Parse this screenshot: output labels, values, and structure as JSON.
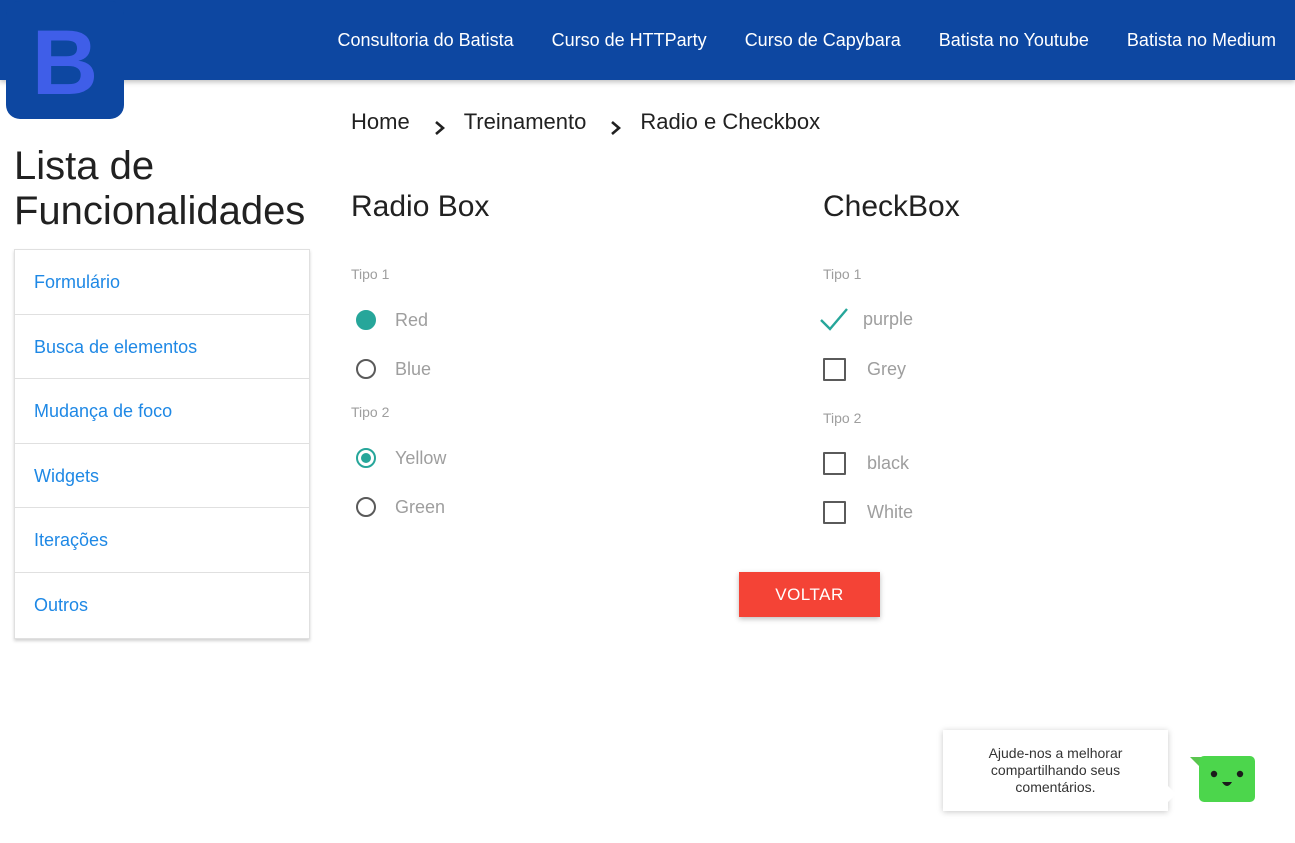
{
  "logo": {
    "letter": "B",
    "bg_color": "#0d47a1",
    "letter_color": "#4169e1"
  },
  "nav": {
    "links": [
      "Consultoria do Batista",
      "Curso de HTTParty",
      "Curso de Capybara",
      "Batista no Youtube",
      "Batista no Medium"
    ]
  },
  "sidebar": {
    "title": "Lista de Funcionalidades",
    "items": [
      "Formulário",
      "Busca de elementos",
      "Mudança de foco",
      "Widgets",
      "Iterações",
      "Outros"
    ]
  },
  "breadcrumb": {
    "items": [
      "Home",
      "Treinamento",
      "Radio e Checkbox"
    ],
    "separator_icon": "chevron-right-icon"
  },
  "radio_box": {
    "title": "Radio Box",
    "groups": [
      {
        "label": "Tipo 1",
        "options": [
          {
            "label": "Red",
            "checked": true
          },
          {
            "label": "Blue",
            "checked": false
          }
        ]
      },
      {
        "label": "Tipo 2",
        "options": [
          {
            "label": "Yellow",
            "checked": true
          },
          {
            "label": "Green",
            "checked": false
          }
        ]
      }
    ]
  },
  "checkbox": {
    "title": "CheckBox",
    "groups": [
      {
        "label": "Tipo 1",
        "options": [
          {
            "label": "purple",
            "checked": true
          },
          {
            "label": "Grey",
            "checked": false
          }
        ]
      },
      {
        "label": "Tipo 2",
        "options": [
          {
            "label": "black",
            "checked": false
          },
          {
            "label": "White",
            "checked": false
          }
        ]
      }
    ]
  },
  "back_button": {
    "label": "VOLTAR",
    "color": "#f44336"
  },
  "feedback": {
    "message": "Ajude-nos a melhorar compartilhando seus comentários.",
    "bot_icon": "smiley-bot-icon",
    "bot_color": "#4caf50"
  },
  "colors": {
    "navbar": "#0d47a1",
    "accent": "#26a69a",
    "link": "#1e88e5"
  }
}
